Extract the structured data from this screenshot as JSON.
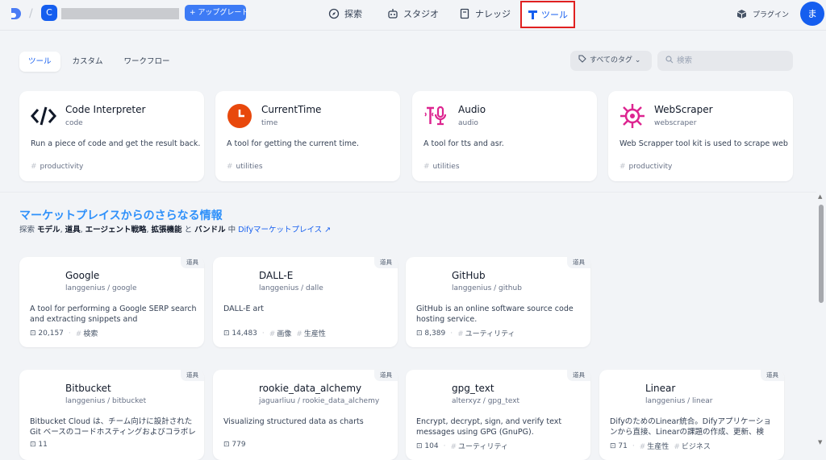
{
  "header": {
    "workspace_initial": "C",
    "upgrade_label": "+ アップグレード",
    "nav": [
      {
        "label": "探索"
      },
      {
        "label": "スタジオ"
      },
      {
        "label": "ナレッジ"
      },
      {
        "label": "ツール"
      }
    ],
    "plugin_label": "プラグイン",
    "avatar_initial": "ま"
  },
  "tabs": [
    {
      "label": "ツール"
    },
    {
      "label": "カスタム"
    },
    {
      "label": "ワークフロー"
    }
  ],
  "tag_filter": "すべてのタグ ⌄",
  "search": {
    "placeholder": "検索"
  },
  "tools": [
    {
      "name": "Code Interpreter",
      "id": "code",
      "desc": "Run a piece of code and get the result back.",
      "tag": "productivity",
      "icon": "code-icon"
    },
    {
      "name": "CurrentTime",
      "id": "time",
      "desc": "A tool for getting the current time.",
      "tag": "utilities",
      "icon": "clock-icon"
    },
    {
      "name": "Audio",
      "id": "audio",
      "desc": "A tool for tts and asr.",
      "tag": "utilities",
      "icon": "audio-icon"
    },
    {
      "name": "WebScraper",
      "id": "webscraper",
      "desc": "Web Scrapper tool kit is used to scrape web",
      "tag": "productivity",
      "icon": "web-icon"
    }
  ],
  "market": {
    "title": "マーケットプレイスからのさらなる情報",
    "sub_pre": "探索",
    "sub_items": [
      "モデル",
      "道具",
      "エージェント戦略",
      "拡張機能"
    ],
    "sub_and": "と",
    "sub_last": "バンドル",
    "sub_mid": "中",
    "link": "Difyマーケットプレイス ↗"
  },
  "plugins": [
    {
      "badge": "道具",
      "name": "Google",
      "org": "langgenius",
      "slug": "google",
      "desc": "A tool for performing a Google SERP search and extracting snippets and webpages.Inp...",
      "installs": "20,157",
      "tags": [
        "検索"
      ]
    },
    {
      "badge": "道具",
      "name": "DALL-E",
      "org": "langgenius",
      "slug": "dalle",
      "desc": "DALL-E art",
      "installs": "14,483",
      "tags": [
        "画像",
        "生産性"
      ]
    },
    {
      "badge": "道具",
      "name": "GitHub",
      "org": "langgenius",
      "slug": "github",
      "desc": "GitHub is an online software source code hosting service.",
      "installs": "8,389",
      "tags": [
        "ユーティリティ"
      ]
    },
    {
      "badge": "道具",
      "name": "Bitbucket",
      "org": "langgenius",
      "slug": "bitbucket",
      "desc": "Bitbucket Cloud は、チーム向けに設計されたGit ベースのコードホスティングおよびコラボレーションツー...",
      "installs": "11",
      "tags": []
    },
    {
      "badge": "道具",
      "name": "rookie_data_alchemy",
      "org": "jaguarliuu",
      "slug": "rookie_data_alchemy",
      "desc": "Visualizing structured data as charts",
      "installs": "779",
      "tags": []
    },
    {
      "badge": "道具",
      "name": "gpg_text",
      "org": "alterxyz",
      "slug": "gpg_text",
      "desc": "Encrypt, decrypt, sign, and verify text messages using GPG (GnuPG).",
      "installs": "104",
      "tags": [
        "ユーティリティ"
      ]
    },
    {
      "badge": "道具",
      "name": "Linear",
      "org": "langgenius",
      "slug": "linear",
      "desc": "DifyのためのLinear統合。Difyアプリケーションから直接、Linearの課題の作成、更新、検索、コメン...",
      "installs": "71",
      "tags": [
        "生産性",
        "ビジネス"
      ]
    }
  ],
  "colors": {
    "accent": "#155eef",
    "highlight_box": "#e02020",
    "market_title": "#2e90fa",
    "clock": "#e8480c",
    "pink": "#dd2590"
  }
}
